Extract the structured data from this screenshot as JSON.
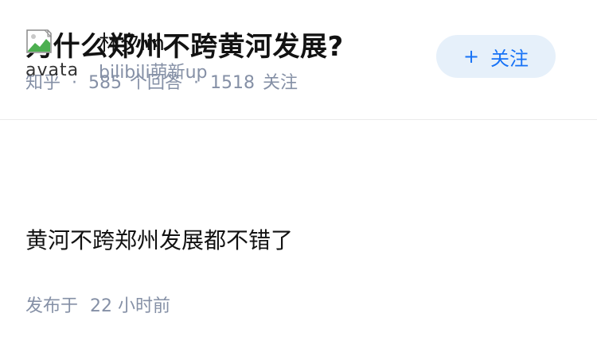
{
  "question": {
    "title": "为什么郑州不跨黄河发展?",
    "source": "知乎",
    "separator": "·",
    "answer_count": "585",
    "answer_label": "个回答",
    "follower_count": "1518",
    "follower_label": "关注"
  },
  "answer": {
    "author": {
      "avatar_alt": "avatar",
      "name": "林夕lin",
      "bio": "bilibili萌新up"
    },
    "follow_button": {
      "icon": "plus-icon",
      "plus": "+",
      "label": "关注"
    },
    "content": "黄河不跨郑州发展都不错了",
    "time_label": "发布于",
    "time_value": "22 小时前"
  },
  "colors": {
    "title": "#121212",
    "meta": "#8590a6",
    "accent": "#1772f6",
    "button_bg": "#e6f0fa",
    "divider": "#ebebeb"
  }
}
